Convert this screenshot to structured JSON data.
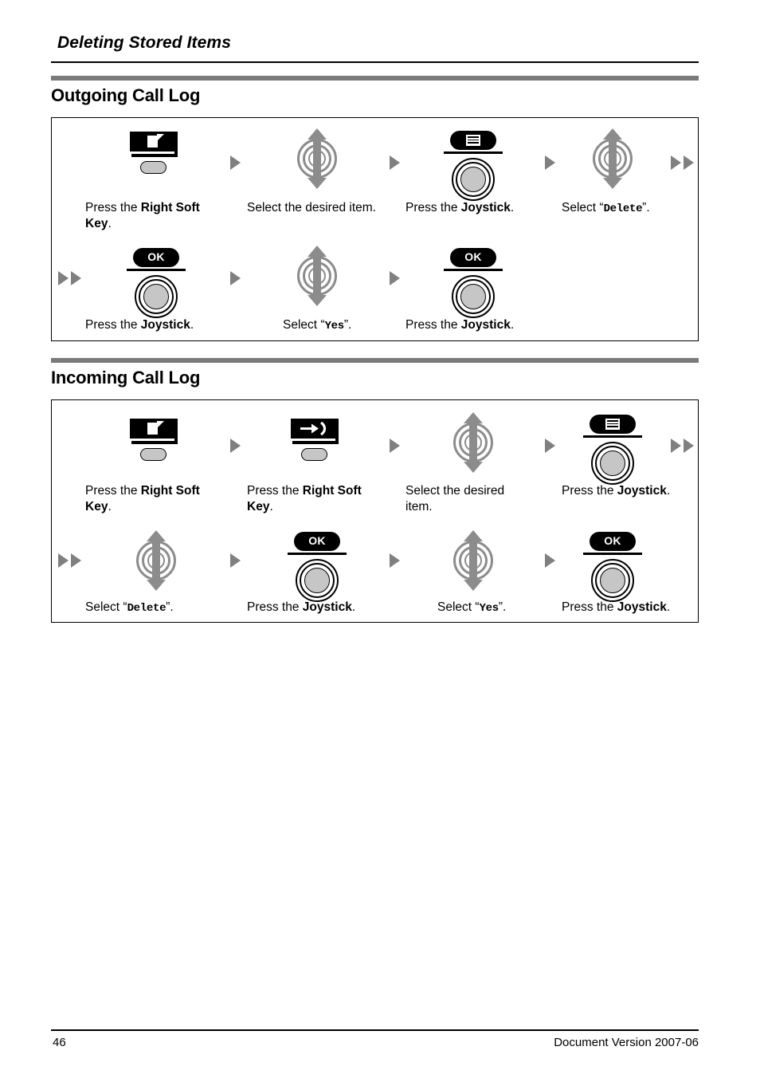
{
  "document": {
    "running_head": "Deleting Stored Items",
    "page_number": "46",
    "document_version": "Document Version 2007-06"
  },
  "sections": [
    {
      "id": "outgoing-call-log",
      "title": "Outgoing Call Log",
      "rows": [
        {
          "steps": [
            {
              "icon": "right-soft-key-page-icon",
              "label_prefix": "Press the ",
              "label_bold": "Right Soft Key",
              "label_suffix": "."
            },
            {
              "icon": "joystick-up-down-arrows-icon",
              "label_prefix": "Select the desired item.",
              "label_bold": "",
              "label_suffix": ""
            },
            {
              "icon": "joystick-menu-icon",
              "label_prefix": "Press the ",
              "label_bold": "Joystick",
              "label_suffix": "."
            },
            {
              "icon": "joystick-up-down-arrows-icon",
              "label_prefix": "Select “",
              "label_mono": "Delete",
              "label_suffix": "”."
            }
          ],
          "trailing_marker": "double-arrow"
        },
        {
          "leading_marker": "double-arrow",
          "steps": [
            {
              "icon": "joystick-ok-icon",
              "label_prefix": "Press the ",
              "label_bold": "Joystick",
              "label_suffix": "."
            },
            {
              "icon": "joystick-up-down-arrows-icon",
              "label_prefix": "Select “",
              "label_mono": "Yes",
              "label_suffix": "”."
            },
            {
              "icon": "joystick-ok-icon",
              "label_prefix": "Press the ",
              "label_bold": "Joystick",
              "label_suffix": "."
            }
          ]
        }
      ]
    },
    {
      "id": "incoming-call-log",
      "title": "Incoming Call Log",
      "rows": [
        {
          "steps": [
            {
              "icon": "right-soft-key-page-icon",
              "label_prefix": "Press the ",
              "label_bold": "Right Soft Key",
              "label_suffix": "."
            },
            {
              "icon": "right-soft-key-incoming-icon",
              "label_prefix": "Press the ",
              "label_bold": "Right Soft Key",
              "label_suffix": "."
            },
            {
              "icon": "joystick-up-down-arrows-icon",
              "label_prefix": "Select the desired item.",
              "label_bold": "",
              "label_suffix": ""
            },
            {
              "icon": "joystick-menu-icon",
              "label_prefix": "Press the ",
              "label_bold": "Joystick",
              "label_suffix": "."
            }
          ],
          "trailing_marker": "double-arrow"
        },
        {
          "leading_marker": "double-arrow",
          "steps": [
            {
              "icon": "joystick-up-down-arrows-icon",
              "label_prefix": "Select “",
              "label_mono": "Delete",
              "label_suffix": "”."
            },
            {
              "icon": "joystick-ok-icon",
              "label_prefix": "Press the ",
              "label_bold": "Joystick",
              "label_suffix": "."
            },
            {
              "icon": "joystick-up-down-arrows-icon",
              "label_prefix": "Select “",
              "label_mono": "Yes",
              "label_suffix": "”."
            },
            {
              "icon": "joystick-ok-icon",
              "label_prefix": "Press the ",
              "label_bold": "Joystick",
              "label_suffix": "."
            }
          ]
        }
      ]
    }
  ],
  "labels": {
    "ok_text": "OK",
    "s1_r1_c1_pre": "Press the ",
    "s1_r1_c1_bold": "Right Soft Key",
    "s1_r1_c1_post": ".",
    "s1_r1_c2": "Select the desired item.",
    "s1_r1_c3_pre": "Press the ",
    "s1_r1_c3_bold": "Joystick",
    "s1_r1_c3_post": ".",
    "s1_r1_c4_pre": "Select “",
    "s1_r1_c4_mono": "Delete",
    "s1_r1_c4_post": "”.",
    "s1_r2_c1_pre": "Press the ",
    "s1_r2_c1_bold": "Joystick",
    "s1_r2_c1_post": ".",
    "s1_r2_c2_pre": "Select “",
    "s1_r2_c2_mono": "Yes",
    "s1_r2_c2_post": "”.",
    "s1_r2_c3_pre": "Press the ",
    "s1_r2_c3_bold": "Joystick",
    "s1_r2_c3_post": ".",
    "s2_r1_c1_pre": "Press the ",
    "s2_r1_c1_bold": "Right Soft Key",
    "s2_r1_c1_post": ".",
    "s2_r1_c2_pre": "Press the ",
    "s2_r1_c2_bold": "Right Soft Key",
    "s2_r1_c2_post": ".",
    "s2_r1_c3": "Select the desired item.",
    "s2_r1_c4_pre": "Press the ",
    "s2_r1_c4_bold": "Joystick",
    "s2_r1_c4_post": ".",
    "s2_r2_c1_pre": "Select “",
    "s2_r2_c1_mono": "Delete",
    "s2_r2_c1_post": "”.",
    "s2_r2_c2_pre": "Press the ",
    "s2_r2_c2_bold": "Joystick",
    "s2_r2_c2_post": ".",
    "s2_r2_c3_pre": "Select “",
    "s2_r2_c3_mono": "Yes",
    "s2_r2_c3_post": "”.",
    "s2_r2_c4_pre": "Press the ",
    "s2_r2_c4_bold": "Joystick",
    "s2_r2_c4_post": "."
  },
  "colors": {
    "section_bar": "#7a7a7a",
    "arrow_marker": "#808080",
    "joystick_fill": "#c6c6c6",
    "joystick_arrow": "#8c8c8c",
    "text": "#000000"
  }
}
